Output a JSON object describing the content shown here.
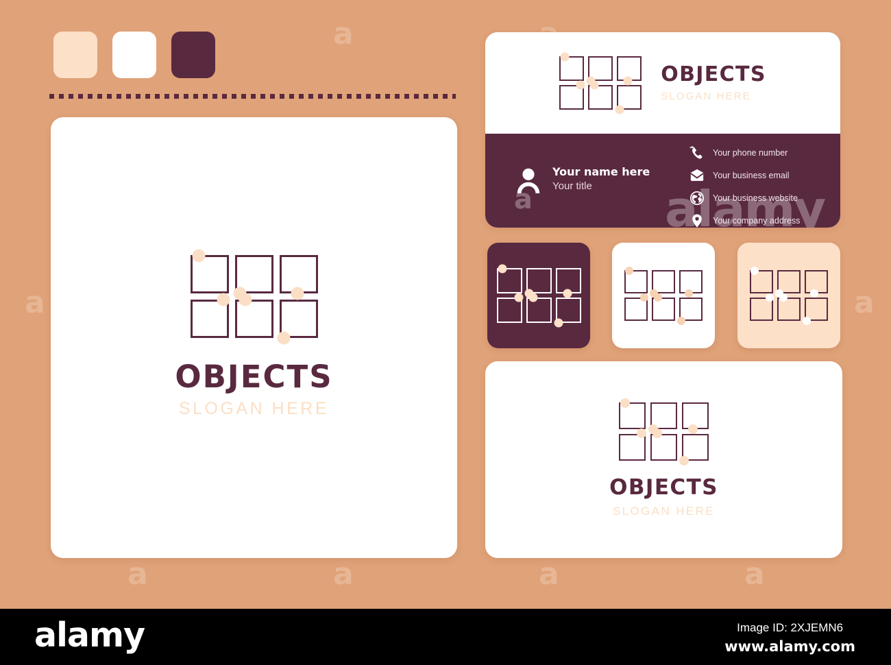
{
  "colors": {
    "background": "#e0a278",
    "plum": "#592940",
    "peach": "#fce0c8",
    "white": "#ffffff",
    "slogan": "#fadfc6"
  },
  "palette": {
    "swatches": [
      {
        "name": "peach-swatch",
        "color": "#fce0c8"
      },
      {
        "name": "white-swatch",
        "color": "#ffffff"
      },
      {
        "name": "plum-swatch",
        "color": "#592940"
      }
    ]
  },
  "brand": {
    "title": "OBJECTS",
    "slogan": "SLOGAN HERE"
  },
  "business_card": {
    "title": "OBJECTS",
    "slogan": "SLOGAN HERE",
    "name": "Your name here",
    "job_title": "Your title",
    "contacts": [
      {
        "icon": "phone-icon",
        "label": "Your phone number"
      },
      {
        "icon": "envelope-icon",
        "label": "Your business email"
      },
      {
        "icon": "globe-icon",
        "label": "Your business website"
      },
      {
        "icon": "location-pin-icon",
        "label": "Your company address"
      }
    ]
  },
  "variants": [
    {
      "name": "variant-plum",
      "background": "#592940",
      "mark_color": "#ffffff",
      "dot_color": "#fce0c8"
    },
    {
      "name": "variant-white",
      "background": "#ffffff",
      "mark_color": "#592940",
      "dot_color": "#f6d3b4"
    },
    {
      "name": "variant-peach",
      "background": "#fce0c8",
      "mark_color": "#592940",
      "dot_color": "#ffffff"
    }
  ],
  "bottom_card": {
    "title": "OBJECTS",
    "slogan": "SLOGAN HERE"
  },
  "watermark": {
    "glyph": "a",
    "wordmark": "alamy"
  },
  "footer": {
    "logo": "alamy",
    "image_id": "Image ID: 2XJEMN6",
    "url": "www.alamy.com"
  }
}
